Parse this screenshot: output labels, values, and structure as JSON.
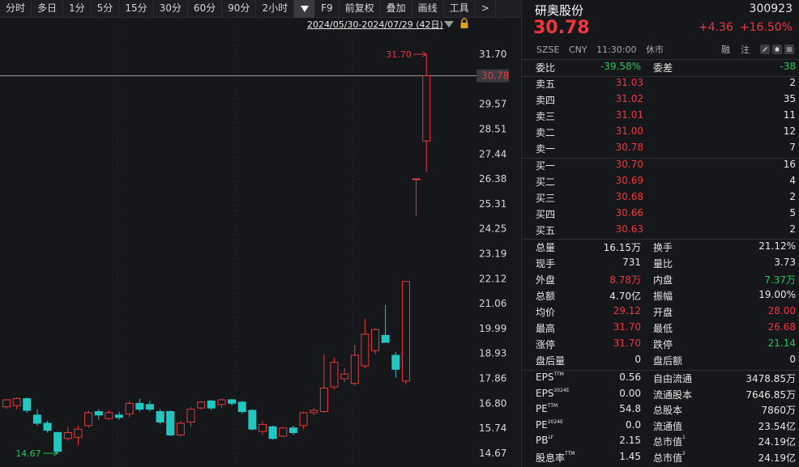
{
  "toolbar": {
    "items": [
      "分时",
      "多日",
      "1分",
      "5分",
      "15分",
      "30分",
      "60分",
      "90分",
      "2小时",
      "F9",
      "前复权",
      "叠加",
      "画线",
      "工具",
      ">"
    ]
  },
  "chart": {
    "range_label": "2024/05/30-2024/07/29 (42日)",
    "current_price_tag": "30.78",
    "high_marker": "31.70",
    "low_marker": "14.67",
    "colors": {
      "up": "#e8383d",
      "down": "#22c7c2",
      "background": "#16171b",
      "price_line": "#9a9a9a"
    }
  },
  "chart_data": {
    "type": "candlestick",
    "ylim": [
      14.4,
      32.2
    ],
    "y_ticks": [
      "31.70",
      "30.78",
      "29.57",
      "28.51",
      "27.44",
      "26.38",
      "25.31",
      "24.25",
      "23.19",
      "22.12",
      "21.06",
      "19.99",
      "18.93",
      "17.86",
      "16.80",
      "15.74",
      "14.67"
    ],
    "candles": [
      {
        "o": 16.65,
        "h": 16.95,
        "l": 16.55,
        "c": 16.95
      },
      {
        "o": 16.7,
        "h": 17.05,
        "l": 16.55,
        "c": 17.0
      },
      {
        "o": 17.0,
        "h": 17.05,
        "l": 16.4,
        "c": 16.5
      },
      {
        "o": 16.3,
        "h": 16.55,
        "l": 15.85,
        "c": 15.95
      },
      {
        "o": 15.95,
        "h": 16.05,
        "l": 15.55,
        "c": 15.65
      },
      {
        "o": 15.55,
        "h": 15.6,
        "l": 14.67,
        "c": 14.75
      },
      {
        "o": 15.3,
        "h": 15.8,
        "l": 15.2,
        "c": 15.55
      },
      {
        "o": 15.35,
        "h": 15.85,
        "l": 15.0,
        "c": 15.7
      },
      {
        "o": 15.85,
        "h": 16.5,
        "l": 15.75,
        "c": 16.4
      },
      {
        "o": 16.45,
        "h": 16.55,
        "l": 16.1,
        "c": 16.3
      },
      {
        "o": 16.15,
        "h": 16.5,
        "l": 16.1,
        "c": 16.4
      },
      {
        "o": 16.3,
        "h": 16.45,
        "l": 16.1,
        "c": 16.2
      },
      {
        "o": 16.35,
        "h": 16.9,
        "l": 16.2,
        "c": 16.8
      },
      {
        "o": 16.8,
        "h": 17.0,
        "l": 16.45,
        "c": 16.55
      },
      {
        "o": 16.75,
        "h": 16.9,
        "l": 16.45,
        "c": 16.55
      },
      {
        "o": 16.45,
        "h": 16.55,
        "l": 15.9,
        "c": 16.0
      },
      {
        "o": 16.45,
        "h": 16.5,
        "l": 15.4,
        "c": 15.45
      },
      {
        "o": 15.45,
        "h": 16.05,
        "l": 15.4,
        "c": 15.95
      },
      {
        "o": 16.0,
        "h": 16.65,
        "l": 15.8,
        "c": 16.55
      },
      {
        "o": 16.6,
        "h": 16.9,
        "l": 16.55,
        "c": 16.85
      },
      {
        "o": 16.9,
        "h": 16.95,
        "l": 16.5,
        "c": 16.6
      },
      {
        "o": 16.75,
        "h": 17.0,
        "l": 16.6,
        "c": 16.95
      },
      {
        "o": 16.95,
        "h": 17.0,
        "l": 16.7,
        "c": 16.8
      },
      {
        "o": 16.85,
        "h": 16.9,
        "l": 16.35,
        "c": 16.45
      },
      {
        "o": 16.5,
        "h": 16.55,
        "l": 15.65,
        "c": 15.7
      },
      {
        "o": 15.6,
        "h": 16.05,
        "l": 15.45,
        "c": 15.9
      },
      {
        "o": 15.8,
        "h": 15.85,
        "l": 15.25,
        "c": 15.3
      },
      {
        "o": 15.4,
        "h": 15.8,
        "l": 15.35,
        "c": 15.75
      },
      {
        "o": 15.75,
        "h": 15.85,
        "l": 15.45,
        "c": 15.55
      },
      {
        "o": 15.85,
        "h": 16.45,
        "l": 15.7,
        "c": 16.4
      },
      {
        "o": 16.4,
        "h": 16.6,
        "l": 16.3,
        "c": 16.5
      },
      {
        "o": 16.45,
        "h": 18.9,
        "l": 16.4,
        "c": 17.45
      },
      {
        "o": 17.5,
        "h": 18.75,
        "l": 17.4,
        "c": 18.55
      },
      {
        "o": 17.85,
        "h": 18.3,
        "l": 17.7,
        "c": 18.05
      },
      {
        "o": 17.65,
        "h": 19.3,
        "l": 17.55,
        "c": 18.85
      },
      {
        "o": 18.4,
        "h": 20.4,
        "l": 18.3,
        "c": 19.75
      },
      {
        "o": 19.05,
        "h": 20.0,
        "l": 18.9,
        "c": 19.95
      },
      {
        "o": 19.7,
        "h": 21.0,
        "l": 19.45,
        "c": 19.4
      },
      {
        "o": 18.85,
        "h": 19.0,
        "l": 17.9,
        "c": 18.25
      },
      {
        "o": 17.75,
        "h": 22.0,
        "l": 17.6,
        "c": 22.0
      },
      {
        "o": 26.38,
        "h": 26.38,
        "l": 24.8,
        "c": 26.38
      },
      {
        "o": 28.0,
        "h": 31.7,
        "l": 26.68,
        "c": 30.78
      }
    ]
  },
  "quote": {
    "name": "研奥股份",
    "code": "300923",
    "price": "30.78",
    "change": "+4.36",
    "change_pct": "+16.50%",
    "market": "SZSE",
    "currency": "CNY",
    "time": "11:30:00",
    "status": "休市",
    "tag_rong": "融",
    "tag_zhu": "注",
    "weibi_label": "委比",
    "weibi": "-39.58%",
    "weicha_label": "委差",
    "weicha": "-38",
    "asks": [
      {
        "label": "卖五",
        "price": "31.03",
        "vol": "2"
      },
      {
        "label": "卖四",
        "price": "31.02",
        "vol": "35"
      },
      {
        "label": "卖三",
        "price": "31.01",
        "vol": "11"
      },
      {
        "label": "卖二",
        "price": "31.00",
        "vol": "12"
      },
      {
        "label": "卖一",
        "price": "30.78",
        "vol": "7"
      }
    ],
    "bids": [
      {
        "label": "买一",
        "price": "30.70",
        "vol": "16"
      },
      {
        "label": "买二",
        "price": "30.69",
        "vol": "4"
      },
      {
        "label": "买三",
        "price": "30.68",
        "vol": "2"
      },
      {
        "label": "买四",
        "price": "30.66",
        "vol": "5"
      },
      {
        "label": "买五",
        "price": "30.63",
        "vol": "2"
      }
    ],
    "stats": [
      {
        "l1": "总量",
        "v1": "16.15万",
        "c1": "",
        "l2": "换手",
        "v2": "21.12%",
        "c2": ""
      },
      {
        "l1": "现手",
        "v1": "731",
        "c1": "",
        "l2": "量比",
        "v2": "3.73",
        "c2": ""
      },
      {
        "l1": "外盘",
        "v1": "8.78万",
        "c1": "red",
        "l2": "内盘",
        "v2": "7.37万",
        "c2": "green"
      },
      {
        "l1": "总额",
        "v1": "4.70亿",
        "c1": "",
        "l2": "振幅",
        "v2": "19.00%",
        "c2": ""
      },
      {
        "l1": "均价",
        "v1": "29.12",
        "c1": "red",
        "l2": "开盘",
        "v2": "28.00",
        "c2": "red"
      },
      {
        "l1": "最高",
        "v1": "31.70",
        "c1": "red",
        "l2": "最低",
        "v2": "26.68",
        "c2": "red"
      },
      {
        "l1": "涨停",
        "v1": "31.70",
        "c1": "red",
        "l2": "跌停",
        "v2": "21.14",
        "c2": "green"
      },
      {
        "l1": "盘后量",
        "v1": "0",
        "c1": "",
        "l2": "盘后额",
        "v2": "0",
        "c2": ""
      }
    ],
    "fundamentals": [
      {
        "l1": "EPS",
        "s1": "TTM",
        "v1": "0.56",
        "l2": "自由流通",
        "s2": "",
        "v2": "3478.85万"
      },
      {
        "l1": "EPS",
        "s1": "2024E",
        "v1": "0.00",
        "l2": "流通股本",
        "s2": "",
        "v2": "7646.85万"
      },
      {
        "l1": "PE",
        "s1": "TTM",
        "v1": "54.8",
        "l2": "总股本",
        "s2": "",
        "v2": "7860万"
      },
      {
        "l1": "PE",
        "s1": "2024E",
        "v1": "0.0",
        "l2": "流通值",
        "s2": "",
        "v2": "23.54亿"
      },
      {
        "l1": "PB",
        "s1": "LF",
        "v1": "2.15",
        "l2": "总市值",
        "s2": "1",
        "v2": "24.19亿"
      },
      {
        "l1": "股息率",
        "s1": "TTM",
        "v1": "1.45",
        "l2": "总市值",
        "s2": "2",
        "v2": "24.19亿"
      }
    ]
  }
}
